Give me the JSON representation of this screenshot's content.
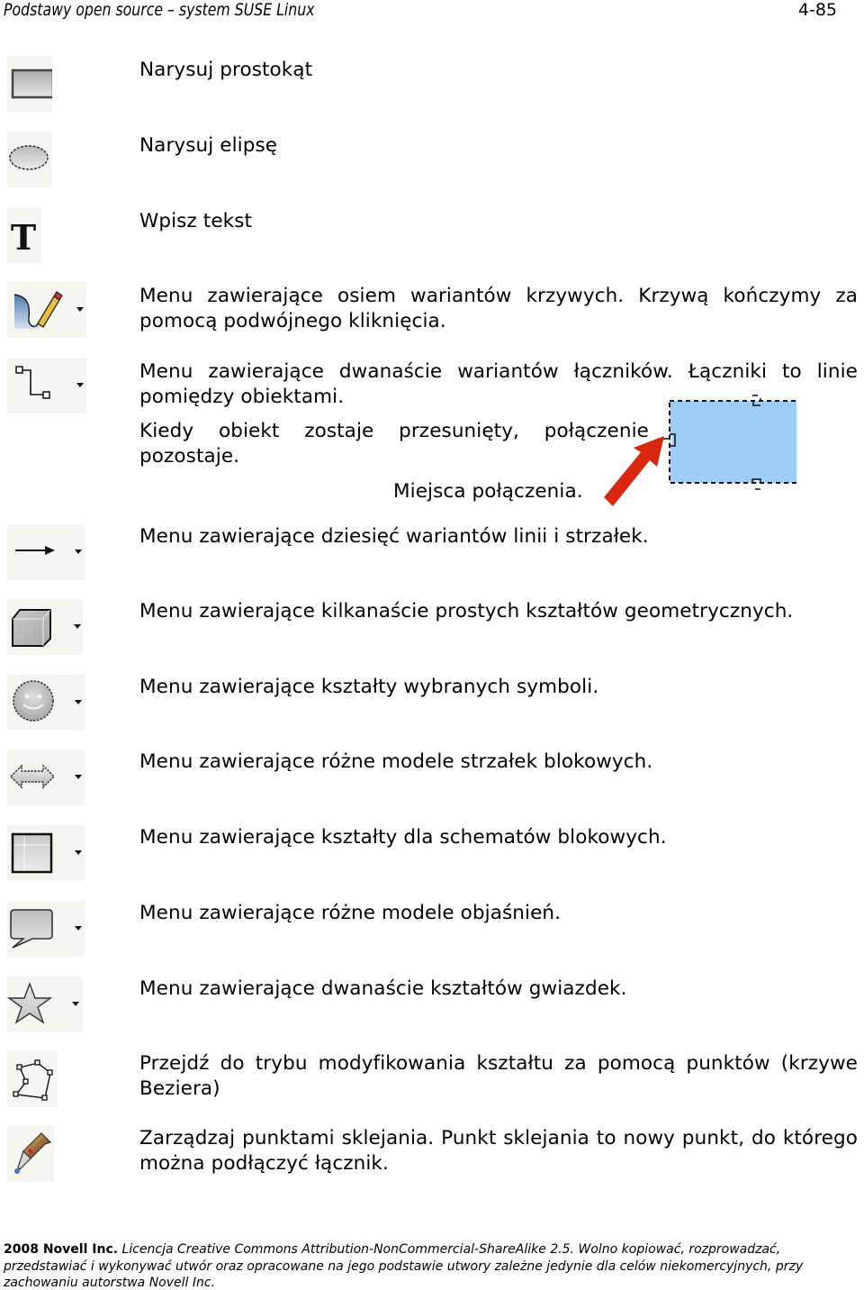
{
  "header": {
    "title": "Podstawy open source – system SUSE Linux",
    "page_number": "4-85"
  },
  "tools": [
    {
      "icon": "rectangle-icon",
      "has_dropdown": false,
      "text": "Narysuj prostokąt"
    },
    {
      "icon": "ellipse-icon",
      "has_dropdown": false,
      "text": "Narysuj elipsę"
    },
    {
      "icon": "text-icon",
      "has_dropdown": false,
      "text": "Wpisz tekst"
    },
    {
      "icon": "curve-pencil-icon",
      "has_dropdown": true,
      "text": "Menu zawierające osiem wariantów krzywych. Krzywą kończymy za pomocą podwójnego kliknięcia."
    },
    {
      "icon": "connector-icon",
      "has_dropdown": true,
      "text": "Menu zawierające dwanaście wariantów łączników. Łączniki to linie pomiędzy obiektami.",
      "text2": "Kiedy obiekt zostaje przesunięty, połączenie pozostaje.",
      "callout": "Miejsca połączenia."
    },
    {
      "icon": "line-arrow-icon",
      "has_dropdown": true,
      "text": "Menu zawierające dziesięć wariantów linii i strzałek."
    },
    {
      "icon": "cube-icon",
      "has_dropdown": true,
      "text": "Menu zawierające kilkanaście prostych kształtów geometrycznych."
    },
    {
      "icon": "smiley-icon",
      "has_dropdown": true,
      "text": "Menu zawierające kształty wybranych symboli."
    },
    {
      "icon": "block-arrow-icon",
      "has_dropdown": true,
      "text": "Menu zawierające różne modele strzałek blokowych."
    },
    {
      "icon": "flowchart-icon",
      "has_dropdown": true,
      "text": "Menu zawierające kształty dla schematów blokowych."
    },
    {
      "icon": "callout-icon",
      "has_dropdown": true,
      "text": "Menu zawierające różne modele objaśnień."
    },
    {
      "icon": "star-icon",
      "has_dropdown": true,
      "text": "Menu zawierające dwanaście kształtów gwiazdek."
    },
    {
      "icon": "points-edit-icon",
      "has_dropdown": false,
      "text": "Przejdź do trybu modyfikowania kształtu za pomocą punktów (krzywe Beziera)"
    },
    {
      "icon": "glue-points-icon",
      "has_dropdown": false,
      "text": "Zarządzaj punktami sklejania. Punkt sklejania to nowy punkt, do którego można podłączyć łącznik."
    }
  ],
  "figure": {
    "shape_color": "#9fcdfa",
    "arrow_color": "#d8260f"
  },
  "footer": {
    "copyright": "2008 Novell Inc.",
    "license_text": " Licencja Creative Commons Attribution-NonCommercial-ShareAlike 2.5. Wolno kopiować, rozprowadzać, przedstawiać i wykonywać utwór oraz opracowane na jego podstawie utwory zależne jedynie dla celów niekomercyjnych, przy zachowaniu autorstwa Novell Inc."
  }
}
